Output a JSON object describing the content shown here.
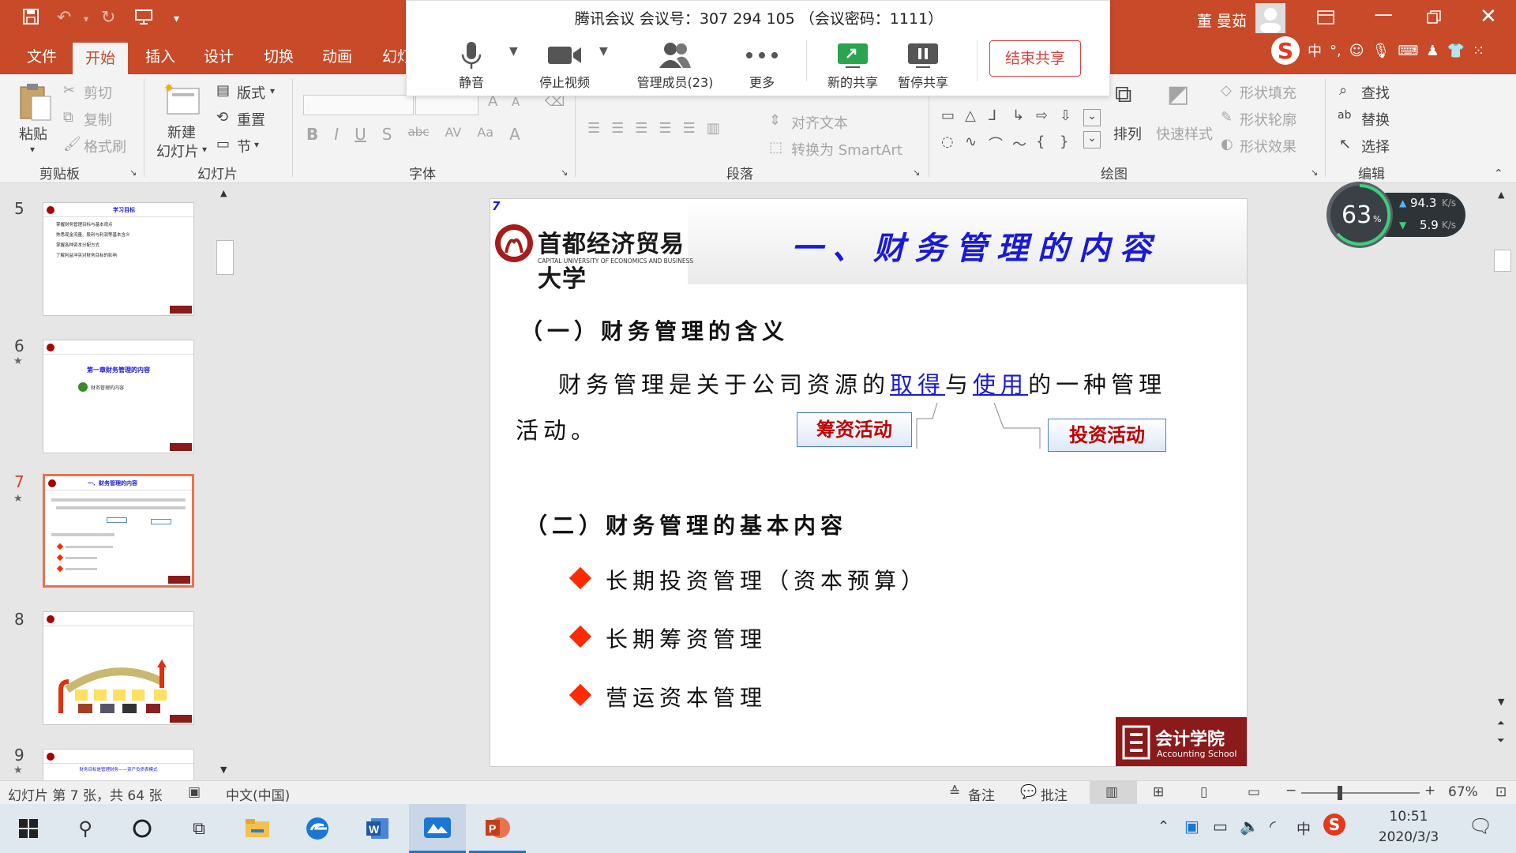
{
  "titlebar": {
    "user": "董 曼茹"
  },
  "menu": {
    "tabs": [
      "文件",
      "开始",
      "插入",
      "设计",
      "切换",
      "动画",
      "幻灯"
    ]
  },
  "ribbon": {
    "clipboard": {
      "paste": "粘贴",
      "cut": "剪切",
      "copy": "复制",
      "format": "格式刷",
      "label": "剪贴板"
    },
    "slides": {
      "new": "新建",
      "new2": "幻灯片",
      "layout": "版式",
      "reset": "重置",
      "section": "节",
      "label": "幻灯片"
    },
    "font": {
      "label": "字体"
    },
    "paragraph": {
      "text_dir": "对齐文本",
      "smartart": "转换为 SmartArt",
      "label": "段落"
    },
    "drawing": {
      "arrange": "排列",
      "quick": "快速样式",
      "fill": "形状填充",
      "outline": "形状轮廓",
      "effect": "形状效果",
      "label": "绘图"
    },
    "editing": {
      "find": "查找",
      "replace": "替换",
      "select": "选择",
      "label": "编辑"
    }
  },
  "meeting": {
    "title": "腾讯会议 会议号：307 294 105 （会议密码：1111）",
    "mute": "静音",
    "stop_video": "停止视频",
    "members": "管理成员(23)",
    "more": "更多",
    "new_share": "新的共享",
    "pause_share": "暂停共享",
    "end_share": "结束共享"
  },
  "netmon": {
    "percent": "63",
    "unit": "%",
    "up": "94.3",
    "down": "5.9",
    "rate_unit": "K/s"
  },
  "thumbs": [
    {
      "num": "5",
      "title": "学习目标",
      "lines": [
        "掌握财务管理目标与基本观点",
        "熟悉现金流量、股利与利润等基本含义",
        "掌握各种资本分配方式",
        "了解利益冲突对财务目标的影响"
      ]
    },
    {
      "num": "6",
      "star": "★",
      "title": "第一章财务管理的内容",
      "sub": "财务管理的内容"
    },
    {
      "num": "7",
      "star": "★",
      "title": "一、财务管理的内容"
    },
    {
      "num": "8"
    },
    {
      "num": "9",
      "star": "★",
      "title": "财务目标是管理财务——资产负债表模式"
    }
  ],
  "slide": {
    "number": "7",
    "univ_cn": "首都经济贸易大学",
    "univ_en": "CAPITAL UNIVERSITY OF ECONOMICS AND BUSINESS",
    "title": "一、财务管理的内容",
    "h1": "（一）财务管理的含义",
    "p1a": "财务管理是关于公司资源的",
    "p1b": "取得",
    "p1c": "与",
    "p1d": "使用",
    "p1e": "的一种管理",
    "p1f": "活动。",
    "callout1": "筹资活动",
    "callout2": "投资活动",
    "h2": "（二）财务管理的基本内容",
    "bullets": [
      "长期投资管理（资本预算）",
      "长期筹资管理",
      "营运资本管理"
    ],
    "school_cn": "会计学院",
    "school_en": "Accounting School"
  },
  "status": {
    "slide_info": "幻灯片 第 7 张，共 64 张",
    "lang": "中文(中国)",
    "notes": "备注",
    "comments": "批注",
    "zoom": "67%"
  },
  "taskbar": {
    "time": "10:51",
    "date": "2020/3/3",
    "ime": "中"
  },
  "colors": {
    "accent": "#c84a29",
    "slide_title": "#1a1ad6",
    "callout_text": "#c00000",
    "bullet": "#ff2a00"
  }
}
